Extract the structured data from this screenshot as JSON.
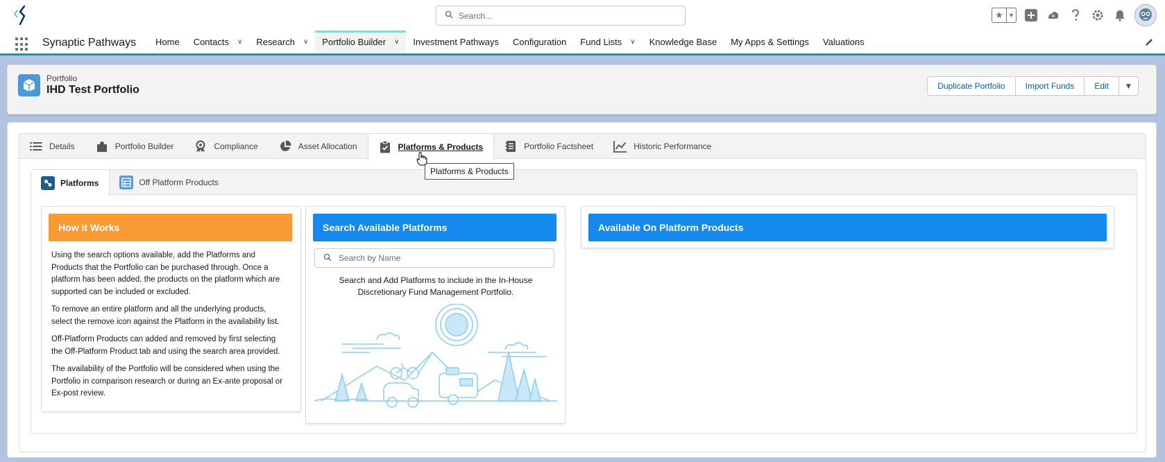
{
  "header": {
    "search_placeholder": "Search..."
  },
  "app": {
    "name": "Synaptic Pathways",
    "nav": [
      {
        "label": "Home",
        "has_menu": false
      },
      {
        "label": "Contacts",
        "has_menu": true
      },
      {
        "label": "Research",
        "has_menu": true
      },
      {
        "label": "Portfolio Builder",
        "has_menu": true,
        "active": true
      },
      {
        "label": "Investment Pathways",
        "has_menu": false
      },
      {
        "label": "Configuration",
        "has_menu": false
      },
      {
        "label": "Fund Lists",
        "has_menu": true
      },
      {
        "label": "Knowledge Base",
        "has_menu": false
      },
      {
        "label": "My Apps & Settings",
        "has_menu": false
      },
      {
        "label": "Valuations",
        "has_menu": false
      }
    ]
  },
  "record": {
    "type": "Portfolio",
    "title": "IHD Test Portfolio",
    "actions": {
      "duplicate": "Duplicate Portfolio",
      "import": "Import Funds",
      "edit": "Edit"
    }
  },
  "tabs": [
    {
      "label": "Details",
      "icon": "list-icon"
    },
    {
      "label": "Portfolio Builder",
      "icon": "puzzle-icon"
    },
    {
      "label": "Compliance",
      "icon": "award-icon"
    },
    {
      "label": "Asset Allocation",
      "icon": "pie-chart-icon"
    },
    {
      "label": "Platforms & Products",
      "icon": "clipboard-check-icon",
      "active": true
    },
    {
      "label": "Portfolio Factsheet",
      "icon": "notebook-icon"
    },
    {
      "label": "Historic Performance",
      "icon": "line-chart-icon"
    }
  ],
  "tooltip": "Platforms & Products",
  "subtabs": [
    {
      "label": "Platforms",
      "active": true
    },
    {
      "label": "Off Platform Products"
    }
  ],
  "how_it_works": {
    "title": "How it Works",
    "paragraphs": [
      "Using the search options available, add the Platforms and Products that the Portfolio can be purchased through. Once a platform has been added, the products on the platform which are supported can be included or excluded.",
      "To remove an entire platform and all the underlying products, select the remove icon against the Platform in the availability list.",
      "Off-Platform Products can added and removed by first selecting the Off-Platform Product tab and using the search area provided.",
      "The availability of the Portfolio will be considered when using the Portfolio in comparison research or during an Ex-ante proposal or Ex-post review."
    ]
  },
  "search_platforms": {
    "title": "Search Available Platforms",
    "placeholder": "Search by Name",
    "hint": "Search and Add Platforms to include in the In-House Discretionary Fund Management Portfolio."
  },
  "available_products": {
    "title": "Available On Platform Products"
  },
  "colors": {
    "accent_teal": "#1b96a4",
    "orange_header": "#f99b34",
    "blue_header": "#1589ee",
    "link_blue": "#0b5cab"
  }
}
